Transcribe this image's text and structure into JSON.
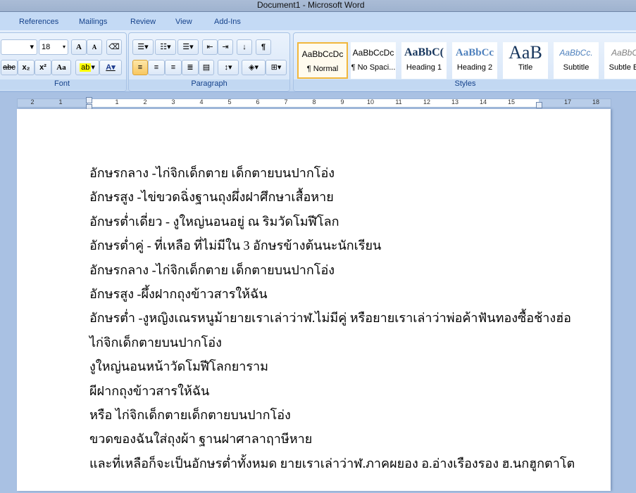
{
  "window": {
    "title": "Document1 - Microsoft Word"
  },
  "tabs": [
    "References",
    "Mailings",
    "Review",
    "View",
    "Add-Ins"
  ],
  "font_group": {
    "label": "Font",
    "size": "18",
    "grow": "A",
    "shrink": "A",
    "case": "Aa",
    "strike": "abc",
    "sub": "x₂",
    "sup": "x²"
  },
  "paragraph_group": {
    "label": "Paragraph",
    "pilcrow": "¶"
  },
  "styles_group": {
    "label": "Styles",
    "items": [
      {
        "preview": "AaBbCcDc",
        "name": "¶ Normal"
      },
      {
        "preview": "AaBbCcDc",
        "name": "¶ No Spaci..."
      },
      {
        "preview": "AaBbC(",
        "name": "Heading 1"
      },
      {
        "preview": "AaBbCc",
        "name": "Heading 2"
      },
      {
        "preview": "AaB",
        "name": "Title"
      },
      {
        "preview": "AaBbCc.",
        "name": "Subtitle"
      },
      {
        "preview": "AaBbCc",
        "name": "Subtle Em"
      }
    ]
  },
  "ruler": {
    "numbers": [
      "2",
      "1",
      "1",
      "2",
      "3",
      "4",
      "5",
      "6",
      "7",
      "8",
      "9",
      "10",
      "11",
      "12",
      "13",
      "14",
      "15",
      "17",
      "18"
    ]
  },
  "document": {
    "lines": [
      "อักษรกลาง -ไก่จิกเด็กตาย เด็กตายบนปากโอ่ง",
      "อักษรสูง -ไข่ขวดฉิ่งฐานถุงผึ่งฝาศึกษาเสื้อหาย",
      "อักษรต่ำเดี่ยว - งูใหญ่นอนอยู่ ณ ริมวัดโมฬีโลก",
      "อักษรต่ำคู่ - ที่เหลือ ที่ไม่มีใน 3  อักษรข้างต้นนะนักเรียน",
      "อักษรกลาง -ไก่จิกเด็กตาย เด็กตายบนปากโอ่ง",
      "อักษรสูง -ผึ้งฝากถุงข้าวสารให้ฉัน",
      "อักษรต่ำ -งูหญิงเณรหนูม้ายายเราเล่าว่าฬ.ไม่มีคู่ หรือยายเราเล่าว่าพ่อค้าฟันทองซื้อช้างฮ่อ",
      "ไก่จิกเด็กตายบนปากโอ่ง",
      "งูใหญ่นอนหน้าวัดโมฬีโลกยาราม",
      "ผีฝากถุงข้าวสารให้ฉัน",
      "หรือ ไก่จิกเด็กตายเด็กตายบนปากโอ่ง",
      "ขวดของฉันใส่ถุงผ้า ฐานฝาศาลาฤาษีหาย",
      "และที่เหลือก็จะเป็นอักษรต่ำทั้งหมด ยายเราเล่าว่าฬ.ภาคผยอง อ.อ่างเรืองรอง ฮ.นกฮูกตาโต"
    ]
  }
}
